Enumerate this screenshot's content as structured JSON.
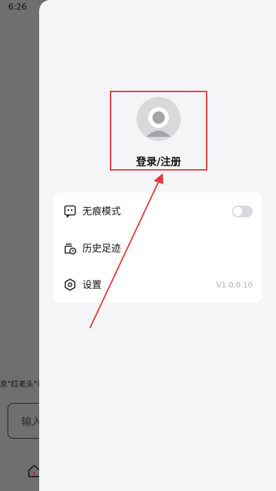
{
  "status_bar": {
    "time": "6:26"
  },
  "background_app": {
    "text": "京\"红老头\"哥",
    "input_placeholder": "输入"
  },
  "drawer": {
    "login_label": "登录/注册",
    "menu": {
      "incognito": {
        "label": "无痕模式",
        "enabled": false
      },
      "history": {
        "label": "历史足迹"
      },
      "settings": {
        "label": "设置",
        "version": "V1.0.0.10"
      }
    }
  },
  "colors": {
    "accent_red": "#e63a3a",
    "drawer_bg": "#f5f5f7",
    "scrim": "#6f6f6f"
  }
}
